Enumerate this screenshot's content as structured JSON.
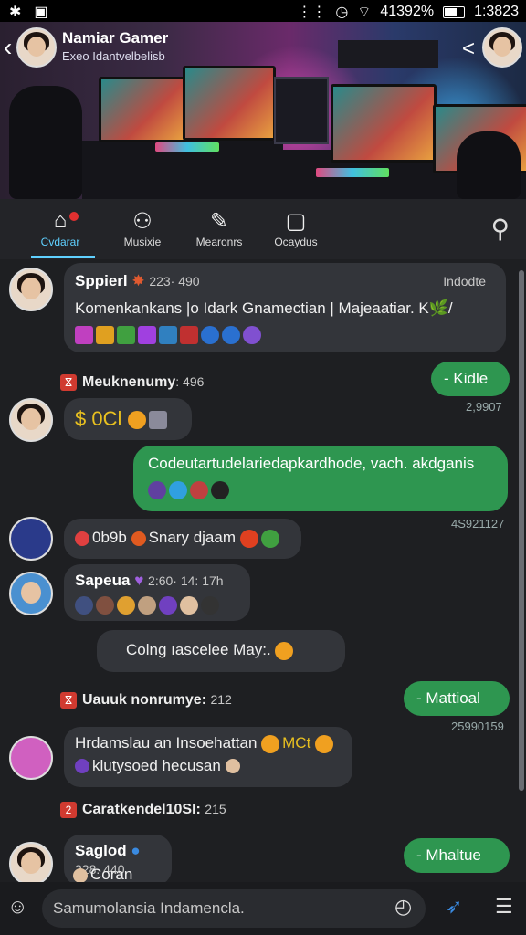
{
  "status_bar": {
    "left_icons": [
      "bluetooth-icon",
      "image-icon"
    ],
    "battery_text": "41392%",
    "time": "1:3823"
  },
  "header": {
    "title": "Namiar Gamer",
    "subtitle": "Exeo Idantvelbelisb"
  },
  "nav": {
    "tabs": [
      {
        "label": "Cvdarar",
        "icon": "home-icon",
        "active": true
      },
      {
        "label": "Musixie",
        "icon": "people-icon",
        "active": false
      },
      {
        "label": "Mearonrs",
        "icon": "edit-icon",
        "active": false
      },
      {
        "label": "Ocaydus",
        "icon": "square-icon",
        "active": false
      }
    ]
  },
  "messages": {
    "m1": {
      "name": "Sppierl",
      "meta": "223· 490",
      "tag": "Indodte",
      "text": "Komenkankans |o Idark Gnamectian | Majeaatiar. K🌿/"
    },
    "m2": {
      "text": "- Kidle",
      "time": "2,9907"
    },
    "sys1": {
      "text": "Meuknenumy",
      "meta": ": 496"
    },
    "m3": {
      "text": "0Cl"
    },
    "m4": {
      "text": "Codeutartudelariedapkardhode, vach. akdganis",
      "time": "4S921127"
    },
    "m5": {
      "text": "0b9b",
      "text2": "Snary djaam"
    },
    "m6": {
      "name": "Sapeua",
      "meta": "2:60· 14: 17h"
    },
    "m7": {
      "text": "Colng ıascelee May:."
    },
    "sys2": {
      "text": "Uauuk nonrumye:",
      "meta": "212"
    },
    "m8": {
      "text": "- Mattioal",
      "time": "25990159"
    },
    "m9": {
      "text": "Hrdamslau an Insoehattan",
      "tag": "MCt",
      "text2": "klutysoed hecusan"
    },
    "sys3": {
      "num": "2",
      "text": "Caratkendel10SI:",
      "meta": "215"
    },
    "m10": {
      "name": "Saglod",
      "meta": "228. 440",
      "text": "Coran"
    },
    "m11": {
      "text": "- Mhaltue"
    }
  },
  "composer": {
    "placeholder": "Samumolansia Indamencla."
  },
  "colors": {
    "accent": "#5fd0ff",
    "sent_bubble": "#2e9650",
    "received_bubble": "#33353a",
    "badge": "#d03a30"
  }
}
